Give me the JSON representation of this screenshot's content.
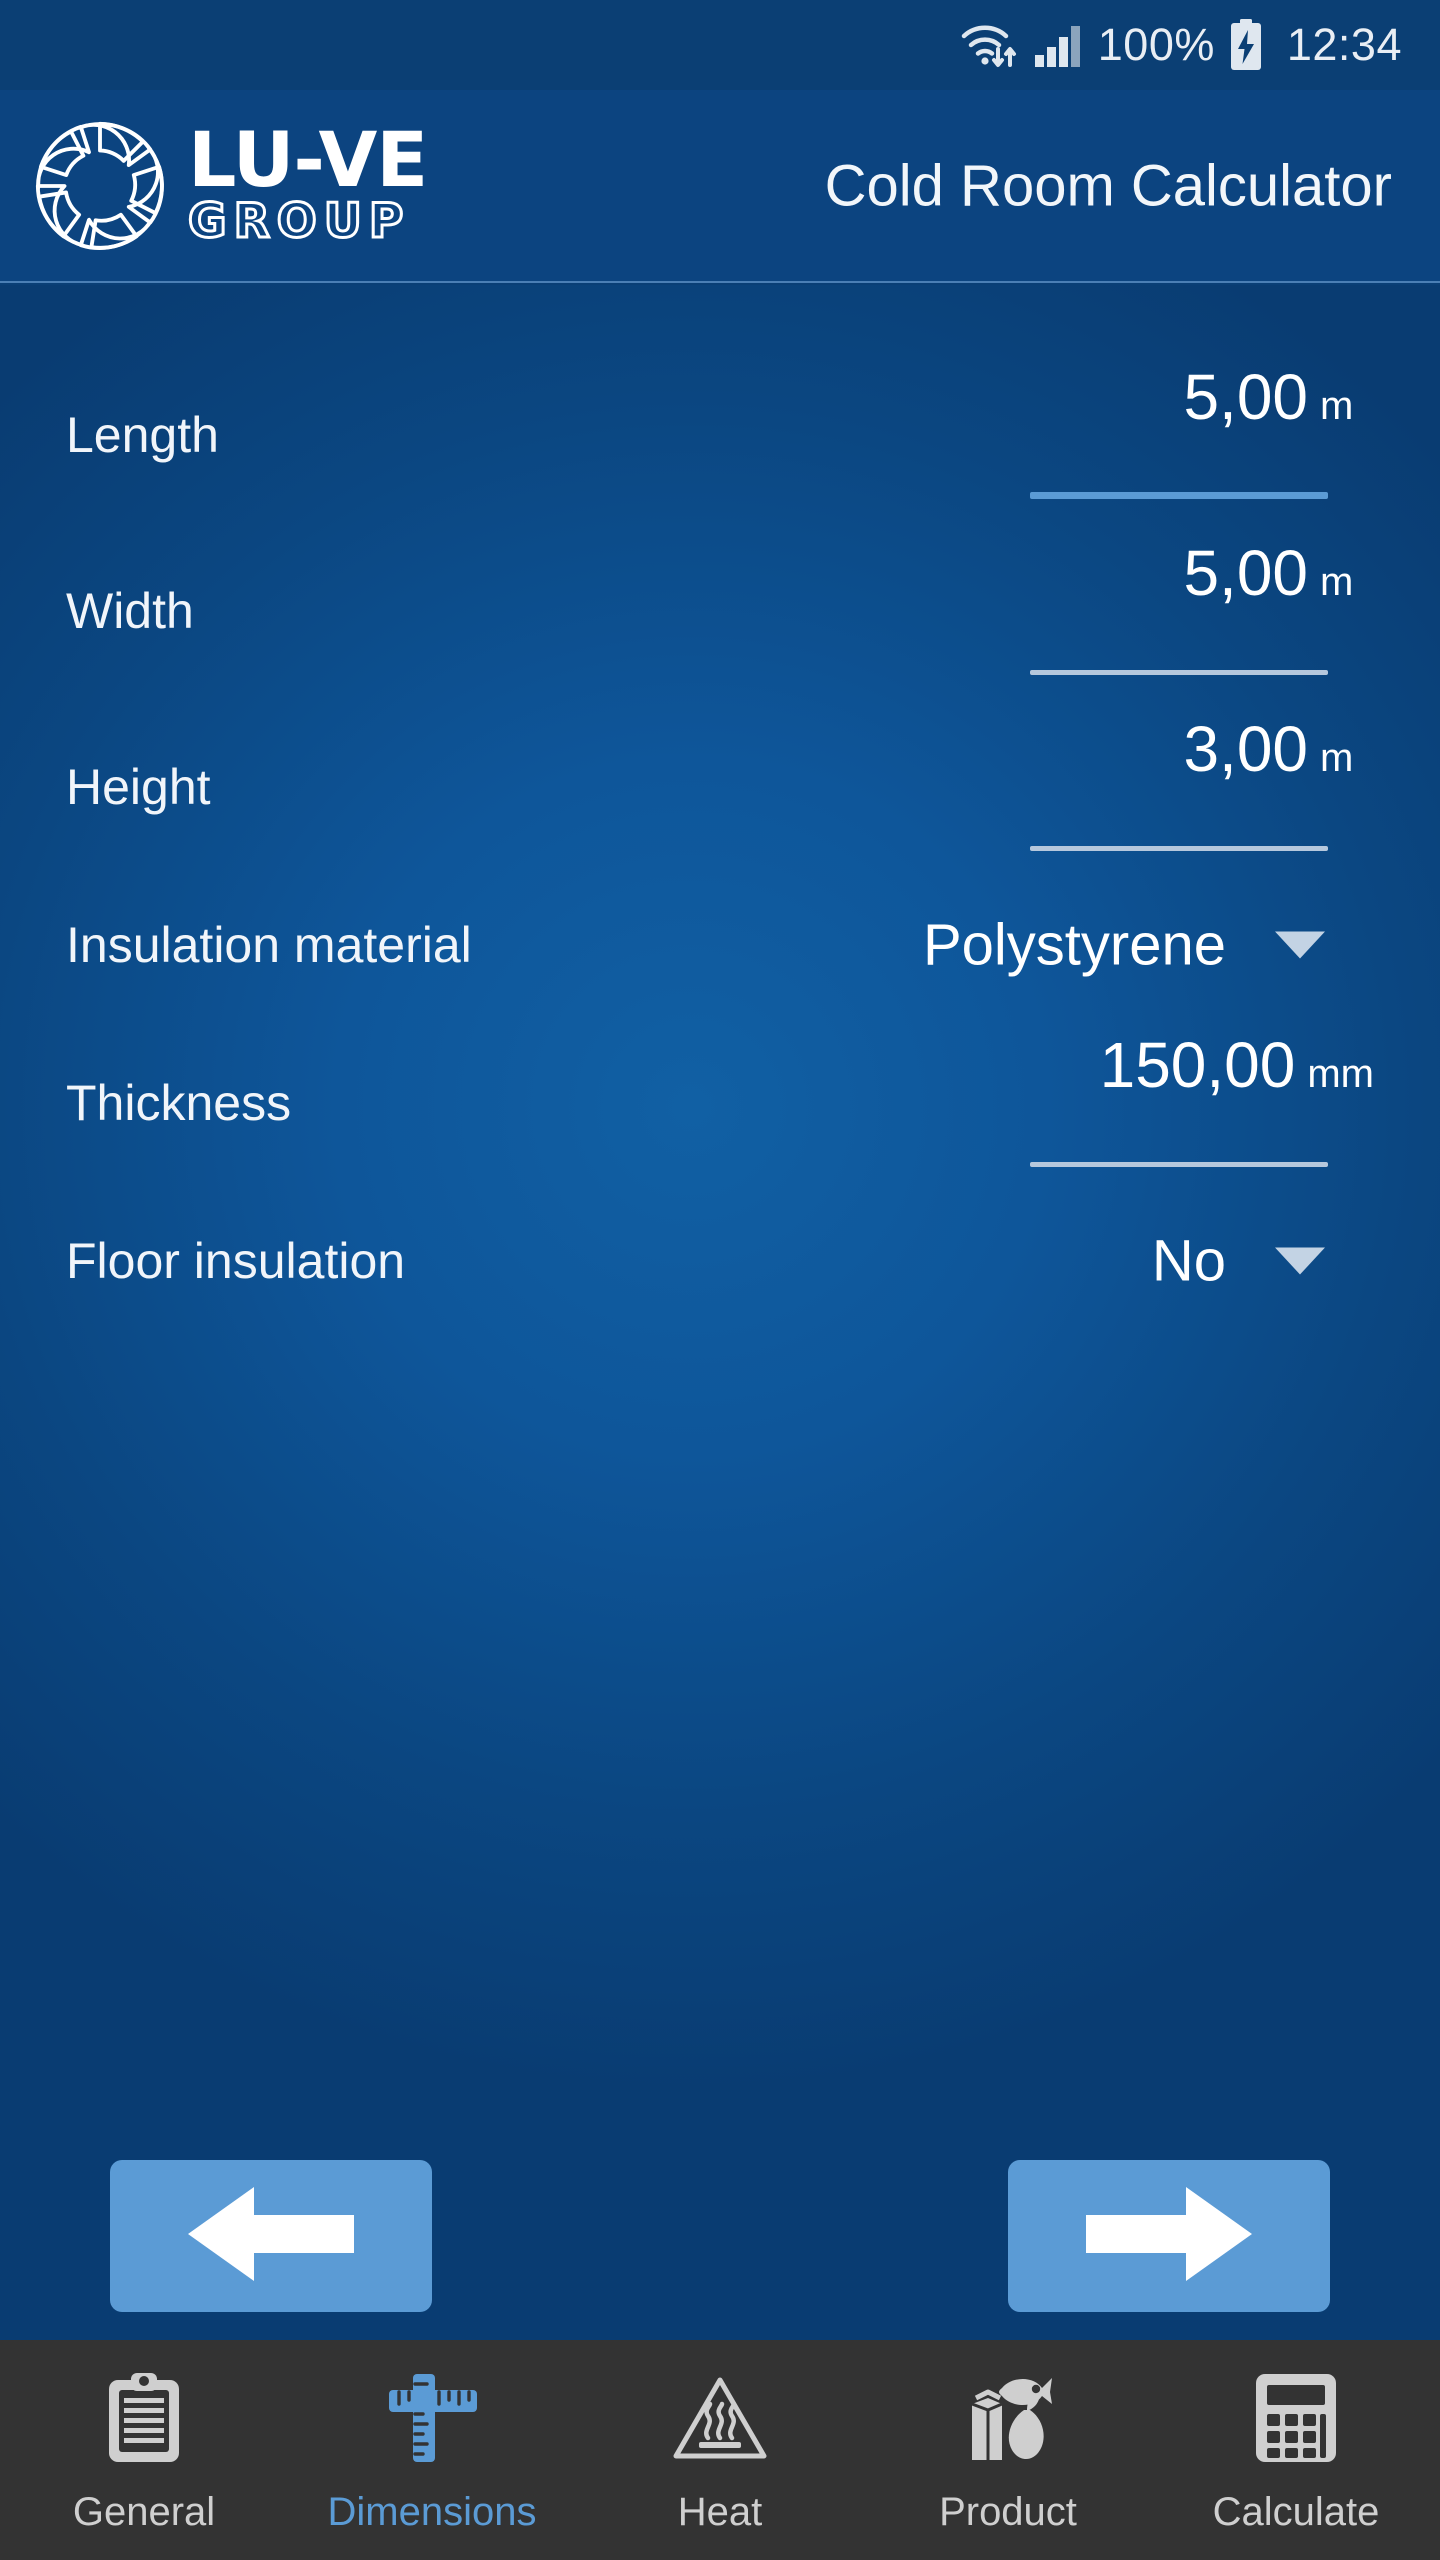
{
  "status_bar": {
    "wifi_icon": "wifi-transfer-icon",
    "signal_icon": "cellular-signal-icon",
    "battery_percent": "100%",
    "battery_icon": "battery-charging-icon",
    "time": "12:34"
  },
  "header": {
    "logo_icon": "lu-ve-fan-logo-icon",
    "logo_primary": "LU-VE",
    "logo_secondary": "GROUP",
    "app_title": "Cold Room Calculator"
  },
  "form": {
    "fields": [
      {
        "label": "Length",
        "type": "number",
        "value": "5,00",
        "unit": "m",
        "focused": true
      },
      {
        "label": "Width",
        "type": "number",
        "value": "5,00",
        "unit": "m",
        "focused": false
      },
      {
        "label": "Height",
        "type": "number",
        "value": "3,00",
        "unit": "m",
        "focused": false
      },
      {
        "label": "Insulation material",
        "type": "select",
        "value": "Polystyrene",
        "caret_icon": "chevron-down-icon"
      },
      {
        "label": "Thickness",
        "type": "number",
        "value": "150,00",
        "unit": "mm",
        "focused": false
      },
      {
        "label": "Floor insulation",
        "type": "select",
        "value": "No",
        "caret_icon": "chevron-down-icon"
      }
    ]
  },
  "navigation": {
    "back_icon": "arrow-left-icon",
    "next_icon": "arrow-right-icon"
  },
  "tabs": [
    {
      "label": "General",
      "icon": "clipboard-icon",
      "active": false
    },
    {
      "label": "Dimensions",
      "icon": "ruler-icon",
      "active": true
    },
    {
      "label": "Heat",
      "icon": "hot-surface-icon",
      "active": false
    },
    {
      "label": "Product",
      "icon": "food-products-icon",
      "active": false
    },
    {
      "label": "Calculate",
      "icon": "calculator-icon",
      "active": false
    }
  ],
  "colors": {
    "header_blue": "#0c4480",
    "background_blue": "#0b4782",
    "accent_blue": "#5b9bd5",
    "underline_idle": "#b6c8dd",
    "tabbar_dark": "#333333",
    "tab_inactive": "#cfcfcf"
  }
}
